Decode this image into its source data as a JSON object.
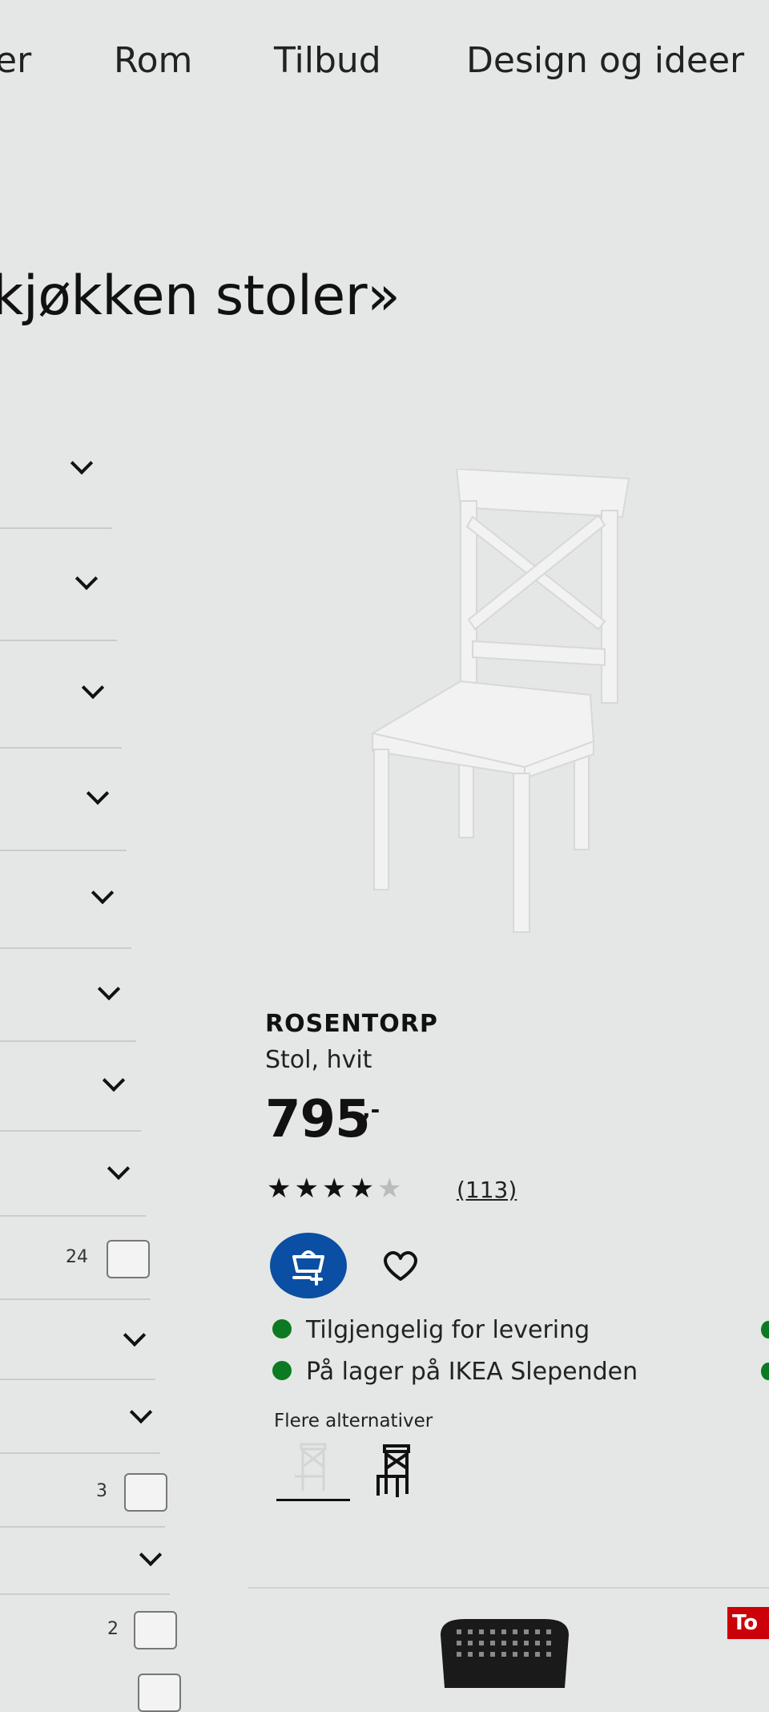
{
  "nav": {
    "items": [
      "er",
      "Rom",
      "Tilbud",
      "Design og ideer"
    ]
  },
  "page": {
    "heading": "kjøkken stoler»"
  },
  "filters": {
    "counts": [
      "24",
      "3",
      "2"
    ]
  },
  "product": {
    "name": "ROSENTORP",
    "description": "Stol, hvit",
    "price": "795",
    "price_suffix": ",-",
    "rating": 4.5,
    "review_count": "(113)",
    "availability": [
      "Tilgjengelig for levering",
      "På lager på IKEA Slependen"
    ],
    "more_options_label": "Flere alternativer",
    "variants": [
      "hvit",
      "svart"
    ]
  },
  "colors": {
    "accent": "#0a4fa3",
    "stock_green": "#0c7a22",
    "badge_red": "#cc0008"
  },
  "badge": {
    "label": "To"
  }
}
